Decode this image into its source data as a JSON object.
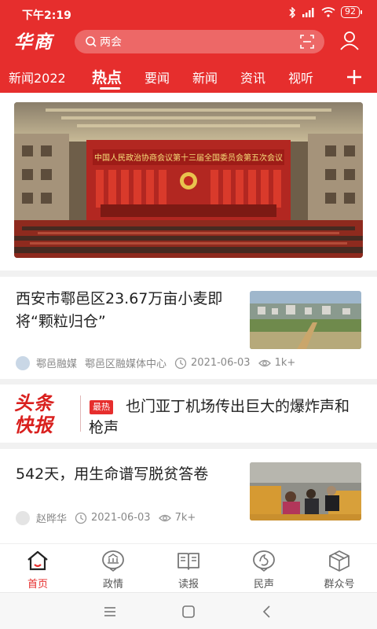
{
  "status_bar": {
    "time": "下午2:19",
    "battery": "92",
    "icons": [
      "bluetooth-icon",
      "signal-icon",
      "wifi-icon",
      "battery-icon"
    ]
  },
  "header": {
    "logo_text": "华商",
    "search_placeholder": "两会",
    "accent_color": "#e62e2d"
  },
  "tabs": [
    {
      "label": "新闻2022",
      "active": false
    },
    {
      "label": "热点",
      "active": true
    },
    {
      "label": "要闻",
      "active": false
    },
    {
      "label": "新闻",
      "active": false
    },
    {
      "label": "资讯",
      "active": false
    },
    {
      "label": "视听",
      "active": false
    }
  ],
  "banner": {
    "hall_banner_text": "中国人民政治协商会议第十三届全国委员会第五次会议"
  },
  "feed": {
    "news1": {
      "title": "西安市鄠邑区23.67万亩小麦即将“颗粒归仓”",
      "source": "鄠邑融媒",
      "org": "鄠邑区融媒体中心",
      "date": "2021-06-03",
      "views": "1k+"
    },
    "headline": {
      "logo_line1": "头条",
      "logo_line2": "快报",
      "badge": "最热",
      "title": "也门亚丁机场传出巨大的爆炸声和枪声"
    },
    "news2": {
      "title": "542天，用生命谱写脱贫答卷",
      "author": "赵晔华",
      "date": "2021-06-03",
      "views": "7k+"
    }
  },
  "bottom_nav": [
    {
      "label": "首页",
      "icon": "home-icon",
      "active": true
    },
    {
      "label": "政情",
      "icon": "government-icon",
      "active": false
    },
    {
      "label": "读报",
      "icon": "newspaper-icon",
      "active": false
    },
    {
      "label": "民声",
      "icon": "voice-icon",
      "active": false
    },
    {
      "label": "群众号",
      "icon": "box-icon",
      "active": false
    }
  ]
}
